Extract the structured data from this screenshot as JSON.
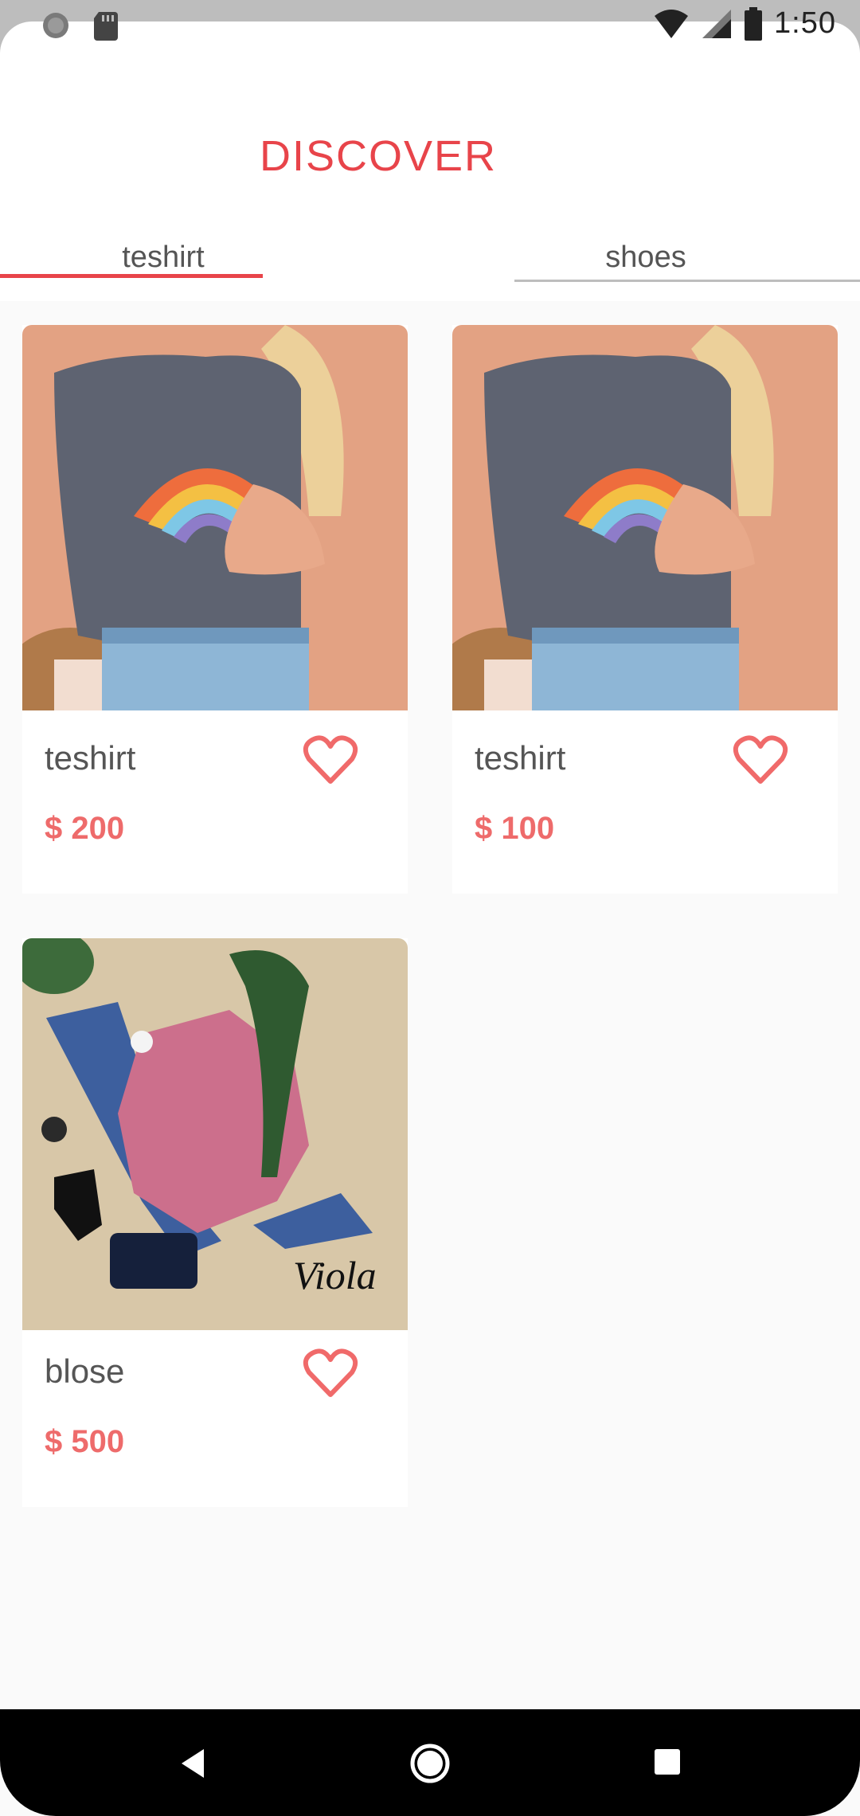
{
  "status_bar": {
    "time": "1:50",
    "icons": [
      "circle-status-icon",
      "sd-card-icon",
      "wifi-icon",
      "signal-icon",
      "battery-icon"
    ]
  },
  "header": {
    "title": "DISCOVER"
  },
  "tabs": [
    {
      "label": "teshirt",
      "selected": true
    },
    {
      "label": "shoes",
      "selected": false
    }
  ],
  "products": [
    {
      "name": "teshirt",
      "price": "$ 200",
      "image": "rainbow-tshirt-photo",
      "favorite_icon": "heart-outline-icon"
    },
    {
      "name": "teshirt",
      "price": "$ 100",
      "image": "rainbow-tshirt-photo",
      "favorite_icon": "heart-outline-icon"
    },
    {
      "name": "blose",
      "price": "$ 500",
      "image": "pink-sweater-outfit-photo",
      "watermark": "Viola",
      "favorite_icon": "heart-outline-icon"
    }
  ],
  "nav_bar": {
    "buttons": [
      "back-icon",
      "home-icon",
      "recents-icon"
    ]
  },
  "colors": {
    "accent": "#e8444a",
    "price": "#ee6b6b",
    "heart": "#f06a6a",
    "background": "#fafafa"
  }
}
